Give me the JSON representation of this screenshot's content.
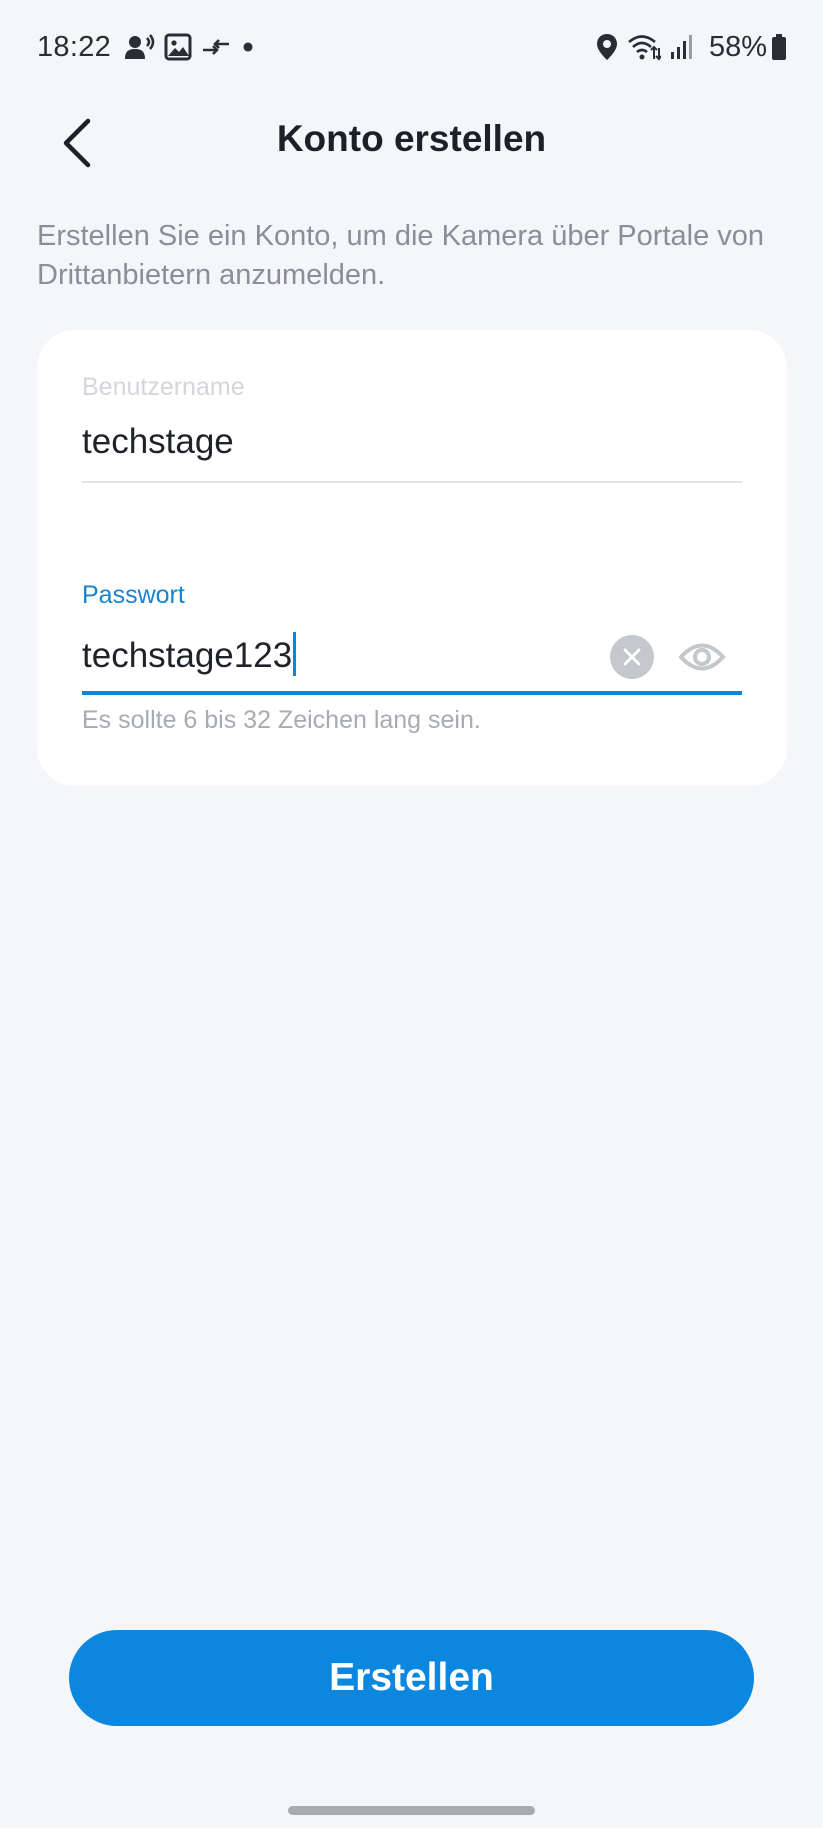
{
  "status_bar": {
    "time": "18:22",
    "battery_percent": "58%",
    "icons_left": [
      "speaker-phone-icon",
      "gallery-icon",
      "data-transfer-icon",
      "notification-dot-icon"
    ],
    "icons_right": [
      "location-icon",
      "wifi-icon",
      "signal-icon",
      "battery-icon"
    ]
  },
  "header": {
    "title": "Konto erstellen"
  },
  "description": "Erstellen Sie ein Konto, um die Kamera über Portale von Drittanbietern anzumelden.",
  "form": {
    "username": {
      "label": "Benutzername",
      "value": "techstage"
    },
    "password": {
      "label": "Passwort",
      "value": "techstage123",
      "helper": "Es sollte 6 bis 32 Zeichen lang sein."
    }
  },
  "actions": {
    "submit_label": "Erstellen"
  },
  "colors": {
    "accent": "#0b87e0",
    "focus": "#1784cf",
    "background": "#f4f6fa",
    "card": "#ffffff"
  }
}
